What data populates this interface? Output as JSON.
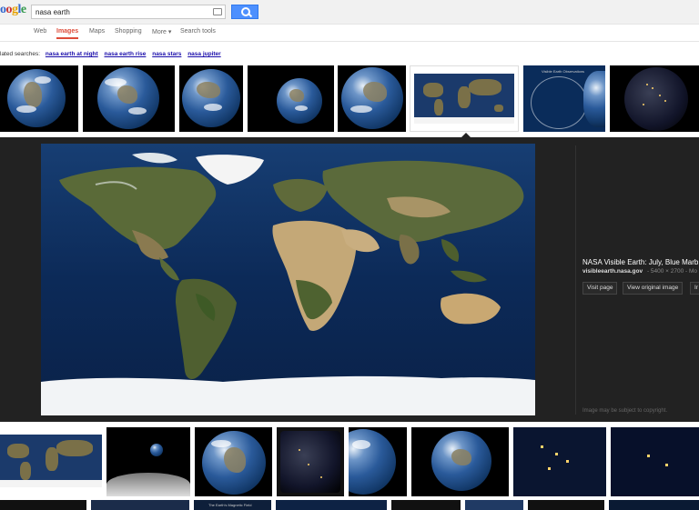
{
  "logo": {
    "text": "oogle"
  },
  "search": {
    "value": "nasa earth"
  },
  "nav": {
    "items": [
      {
        "label": "Web"
      },
      {
        "label": "Images"
      },
      {
        "label": "Maps"
      },
      {
        "label": "Shopping"
      },
      {
        "label": "More ▾"
      },
      {
        "label": "Search tools"
      }
    ],
    "active_index": 1
  },
  "related": {
    "label": "lated searches:",
    "links": [
      "nasa earth at night",
      "nasa earth rise",
      "nasa stars",
      "nasa jupiter"
    ]
  },
  "row1_thumbs": [
    {
      "kind": "globe"
    },
    {
      "kind": "globe"
    },
    {
      "kind": "globe"
    },
    {
      "kind": "globe"
    },
    {
      "kind": "globe"
    },
    {
      "kind": "map",
      "selected": true
    },
    {
      "kind": "diagram"
    },
    {
      "kind": "night"
    }
  ],
  "row1_captions": {
    "diagram": "Visible Earth Observations"
  },
  "preview": {
    "title": "NASA Visible Earth: July, Blue Marb",
    "site": "visibleearth.nasa.gov",
    "size": "- 5400 × 2700 - Mo",
    "buttons": [
      "Visit page",
      "View original image",
      "Ir"
    ],
    "copyright": "Image may be subject to copyright."
  },
  "row3_captions": {
    "magnetic": "The Earth's Magnetic Field"
  },
  "colors": {
    "accent": "#dd4b39",
    "link": "#1a0dab",
    "search_button": "#4d90fe",
    "preview_bg": "#222222"
  }
}
